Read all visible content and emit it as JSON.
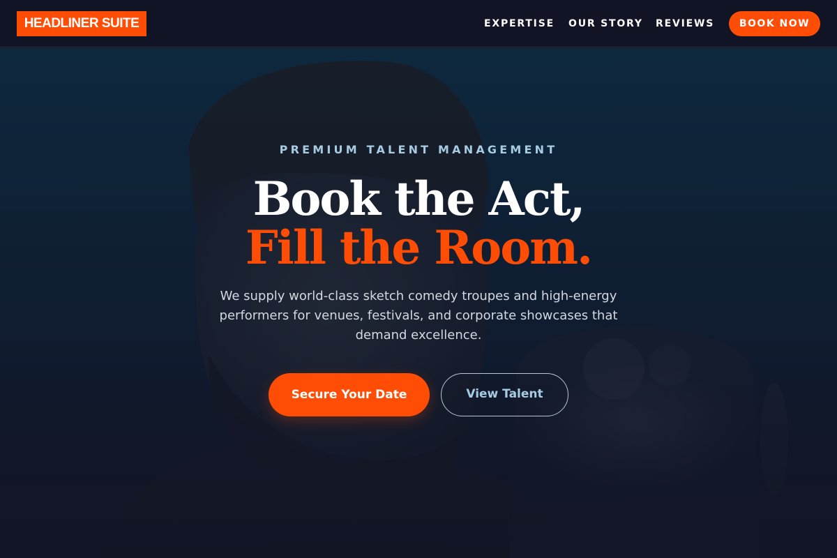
{
  "header": {
    "logo_text": "HEADLINER SUITE",
    "nav": {
      "expertise": "EXPERTISE",
      "our_story": "OUR STORY",
      "reviews": "REVIEWS"
    },
    "cta_label": "BOOK NOW"
  },
  "hero": {
    "eyebrow": "PREMIUM TALENT MANAGEMENT",
    "headline_line1": "Book the Act,",
    "headline_line2": "Fill the Room.",
    "lead": "We supply world-class sketch comedy troupes and high-energy performers for venues, festivals, and corporate showcases that demand excellence.",
    "primary_button": "Secure Your Date",
    "secondary_button": "View Talent"
  },
  "colors": {
    "accent": "#ff4d06",
    "header_bg": "#101425",
    "eyebrow": "#a7cbe2",
    "body_text": "#d4d8e2"
  }
}
